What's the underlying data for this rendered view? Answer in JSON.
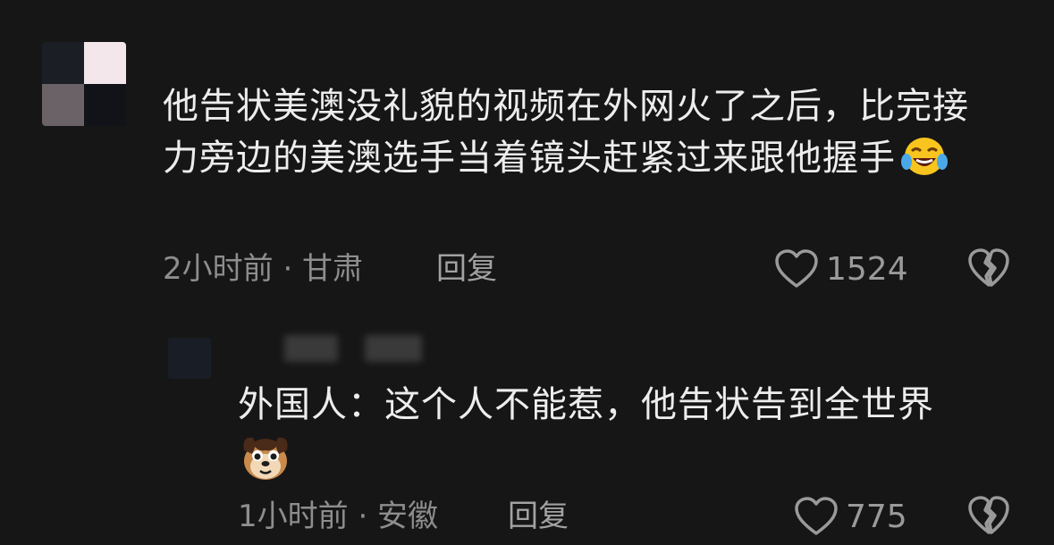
{
  "comment": {
    "text": "他告状美澳没礼貌的视频在外网火了之后，比完接力旁边的美澳选手当着镜头赶紧过来跟他握手",
    "emoji": "laughing-crying-emoji",
    "meta": "2小时前 · 甘肃",
    "reply_label": "回复",
    "likes": "1524"
  },
  "reply": {
    "text": "外国人：这个人不能惹，他告状告到全世界",
    "emoji": "dog-emoji",
    "meta": "1小时前 · 安徽",
    "reply_label": "回复",
    "likes": "775"
  },
  "icons": {
    "like": "heart-icon",
    "dislike": "broken-heart-icon"
  },
  "colors": {
    "background": "#161616",
    "text": "#ededed",
    "meta": "#8d8d8d"
  }
}
